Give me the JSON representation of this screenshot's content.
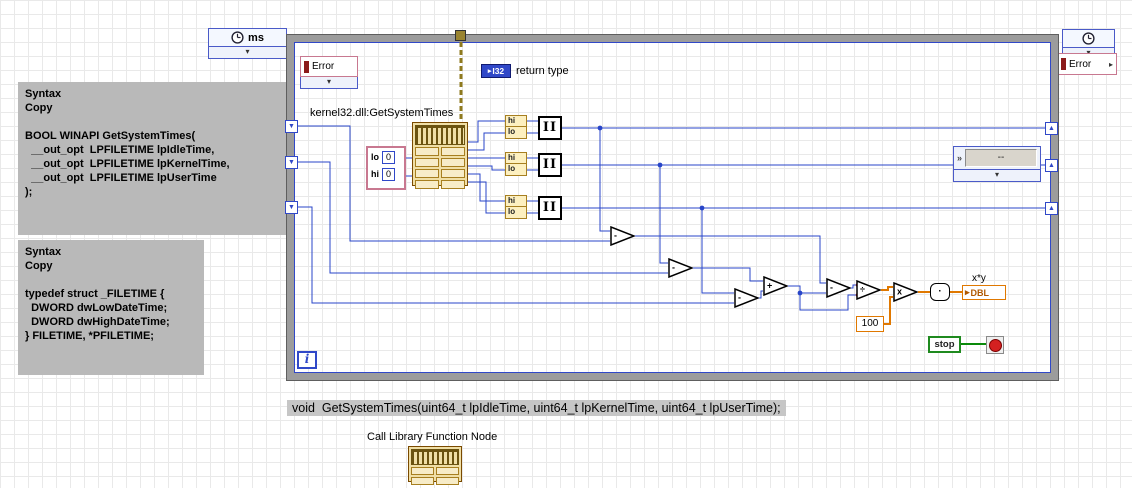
{
  "colors": {
    "wire_blue": "#2845c8",
    "wire_orange": "#e07800",
    "wire_green": "#0a8a0a",
    "wire_error": "#8f7a1e",
    "loop_border": "#9c9c9c",
    "doc_bg": "#b9b9b9",
    "clfn_bg": "#f0dfa6",
    "dbl_orange": "#e07800",
    "stop_green": "#1f8a1f"
  },
  "icons": {
    "chevron_down": "▾",
    "chevron_right": "▸",
    "sr_down": "▼",
    "sr_up": "▲",
    "join_glyph": "II",
    "display_glyph": "»",
    "dbl_arrow": "▸",
    "i32_arrow": "▸"
  },
  "doc_boxes": {
    "getsystemtimes": "Syntax\nCopy\n\nBOOL WINAPI GetSystemTimes(\n  __out_opt  LPFILETIME lpIdleTime,\n  __out_opt  LPFILETIME lpKernelTime,\n  __out_opt  LPFILETIME lpUserTime\n);",
    "filetime": "Syntax\nCopy\n\ntypedef struct _FILETIME {\n  DWORD dwLowDateTime;\n  DWORD dwHighDateTime;\n} FILETIME, *PFILETIME;"
  },
  "wait_node": {
    "label": "ms"
  },
  "error_in": {
    "label": "Error"
  },
  "error_out": {
    "label": "Error"
  },
  "clfn": {
    "caption": "kernel32.dll:GetSystemTimes"
  },
  "return_type": {
    "terminal": "I32",
    "label": "return type"
  },
  "input_cluster": {
    "lo_label": "lo",
    "lo_value": "0",
    "hi_label": "hi",
    "hi_value": "0"
  },
  "joins": [
    {
      "hi": "hi",
      "lo": "lo"
    },
    {
      "hi": "hi",
      "lo": "lo"
    },
    {
      "hi": "hi",
      "lo": "lo"
    }
  ],
  "operators": {
    "sub1": "-",
    "sub2": "-",
    "sub3": "-",
    "add": "+",
    "sub4": "-",
    "div": "÷",
    "mul": "x",
    "round": "·"
  },
  "constant_100": "100",
  "result": {
    "label": "x*y",
    "terminal": "DBL"
  },
  "display": {
    "value": "--"
  },
  "stop_button": {
    "label": "stop"
  },
  "loop": {
    "iteration_label": "i"
  },
  "code_caption": "void  GetSystemTimes(uint64_t lpIdleTime, uint64_t lpKernelTime, uint64_t lpUserTime);",
  "palette": {
    "label": "Call Library Function Node"
  }
}
